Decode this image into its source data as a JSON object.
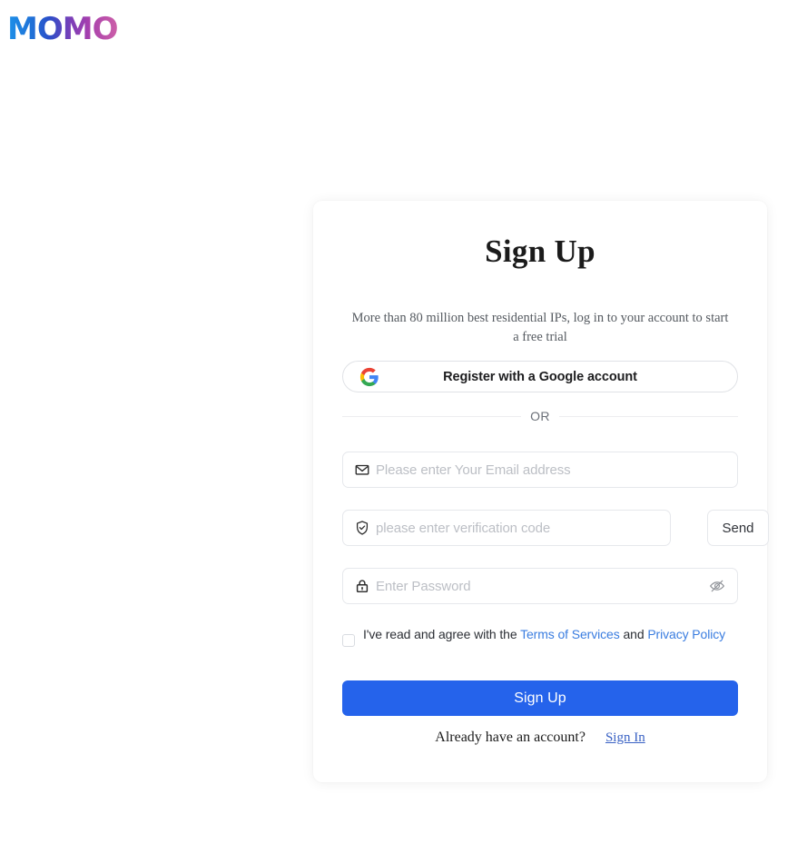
{
  "brand": {
    "logo_text": "MOMO",
    "gradient_start": "#1e90e8",
    "gradient_mid": "#7b3fb8",
    "gradient_end": "#cc5fa8"
  },
  "card": {
    "title": "Sign Up",
    "subtitle": "More than 80 million best residential IPs, log in to your account to start a free trial",
    "google_button": {
      "label": "Register with a Google account",
      "icon": "google-g-icon"
    },
    "divider_label": "OR",
    "fields": {
      "email": {
        "placeholder": "Please enter Your Email address",
        "value": "",
        "icon": "envelope-icon"
      },
      "verification_code": {
        "placeholder": "please enter verification code",
        "value": "",
        "icon": "shield-check-icon",
        "send_label": "Send"
      },
      "password": {
        "placeholder": "Enter Password",
        "value": "",
        "icon": "lock-icon",
        "toggle_icon": "eye-slash-icon"
      }
    },
    "terms": {
      "checked": false,
      "prefix": "I've read and agree with the",
      "terms_link": "Terms of Services",
      "conjunction": "and",
      "privacy_link": "Privacy Policy"
    },
    "submit_label": "Sign Up",
    "footer": {
      "question": "Already have an account?",
      "signin_label": "Sign In"
    }
  },
  "colors": {
    "primary": "#2563eb",
    "link": "#3a7de0",
    "placeholder": "#bcbfc5",
    "border": "#e6e8ec",
    "background": "#ffffff"
  }
}
